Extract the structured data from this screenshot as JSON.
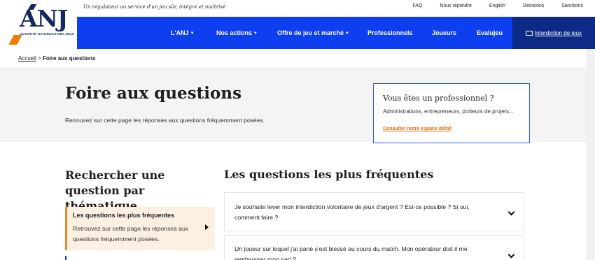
{
  "header": {
    "logo_word": "ANJ",
    "logo_subtitle": "AUTORITÉ NATIONALE DES JEUX",
    "tagline": "Un régulateur au service d'un jeu sûr, intègre et maîtrisé",
    "top_links": [
      "FAQ",
      "Nous rejoindre",
      "English",
      "Décisions",
      "Sanctions"
    ]
  },
  "nav": {
    "items": [
      {
        "label": "L'ANJ",
        "dropdown": true
      },
      {
        "label": "Nos actions",
        "dropdown": true
      },
      {
        "label": "Offre de jeu et marché",
        "dropdown": true
      },
      {
        "label": "Professionnels",
        "dropdown": false
      },
      {
        "label": "Joueurs",
        "dropdown": false
      },
      {
        "label": "Evalujeu",
        "dropdown": false
      }
    ],
    "special": "Interdiction de jeux",
    "caret": "▼"
  },
  "breadcrumb": {
    "home": "Accueil",
    "separator": ">",
    "current": "Foire aux questions"
  },
  "hero": {
    "title": "Foire aux questions",
    "description": "Retrouvez sur cette page les réponses aux questions fréquemment posées."
  },
  "pro_card": {
    "title": "Vous êtes un professionnel ?",
    "text": "Administrations, entrepreneurs, porteurs de projets...",
    "link": "Consulter notre espace dédié"
  },
  "sidebar": {
    "title": "Rechercher une question par thématique",
    "active_item": {
      "title": "Les questions les plus fréquentes",
      "description": "Retrouvez sur cette page les réponses aux questions fréquemment posées."
    }
  },
  "main": {
    "title": "Les questions les plus fréquentes",
    "questions": [
      "Je souhaite lever mon interdiction volontaire de jeux d'argent ? Est-ce possible ? Si oui, comment faire ?",
      "Un joueur sur lequel j'ai parié s'est blessé au cours du match. Mon opérateur doit-il me rembourser mon pari ?"
    ]
  },
  "colors": {
    "nav_blue": "#0d3ef0",
    "nav_dark": "#0c2a86",
    "logo_navy": "#14285a",
    "accent_orange": "#f07d00",
    "link_orange": "#d86a10"
  }
}
